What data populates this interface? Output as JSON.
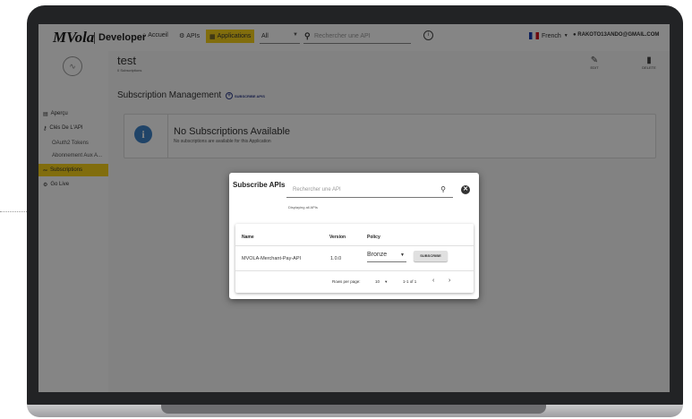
{
  "header": {
    "logo": "MVola",
    "brand": "Developer",
    "nav": {
      "home": "Accueil",
      "apis": "APIs",
      "applications": "Applications"
    },
    "filter_value": "All",
    "search_placeholder": "Rechercher une API",
    "language": "French",
    "user_email": "RAKOTO13ANDO@GMAIL.COM"
  },
  "sidebar": {
    "items": [
      {
        "label": "Aperçu"
      },
      {
        "label": "Clés De L'API"
      },
      {
        "label": "OAuth2 Tokens"
      },
      {
        "label": "Abonnement Aux A..."
      },
      {
        "label": "Subscriptions"
      },
      {
        "label": "Go Live"
      }
    ]
  },
  "app": {
    "title": "test",
    "subscriptions_count": "0 Subscriptions",
    "edit_label": "EDIT",
    "delete_label": "DELETE"
  },
  "subscription": {
    "title": "Subscription Management",
    "subscribe_apis_label": "SUBSCRIBE APIS",
    "empty_title": "No Subscriptions Available",
    "empty_subtitle": "No subscriptions are available for this Application"
  },
  "modal": {
    "title": "Subscribe APIs",
    "search_placeholder": "Rechercher une API",
    "displaying": "Displaying all APIs",
    "columns": [
      "Name",
      "Version",
      "Policy"
    ],
    "row": {
      "name": "MVOLA-Merchant-Pay-API",
      "version": "1.0.0",
      "policy": "Bronze",
      "action_label": "SUBSCRIBE"
    },
    "rows_per_page_label": "Rows per page:",
    "rows_per_page_value": "10",
    "range": "1-1 of 1"
  }
}
